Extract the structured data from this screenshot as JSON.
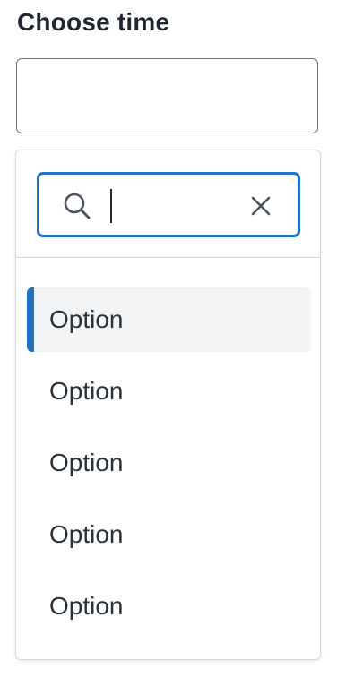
{
  "field": {
    "label": "Choose time",
    "selected_value": ""
  },
  "search": {
    "value": "",
    "placeholder": ""
  },
  "options": [
    {
      "label": "Option",
      "active": true
    },
    {
      "label": "Option",
      "active": false
    },
    {
      "label": "Option",
      "active": false
    },
    {
      "label": "Option",
      "active": false
    },
    {
      "label": "Option",
      "active": false
    }
  ],
  "icons": {
    "search": "search-icon",
    "clear": "close-icon"
  },
  "colors": {
    "accent": "#1f72c4",
    "active_option_bg": "#f3f4f6",
    "border": "#6b7480",
    "text": "#1f2733"
  }
}
